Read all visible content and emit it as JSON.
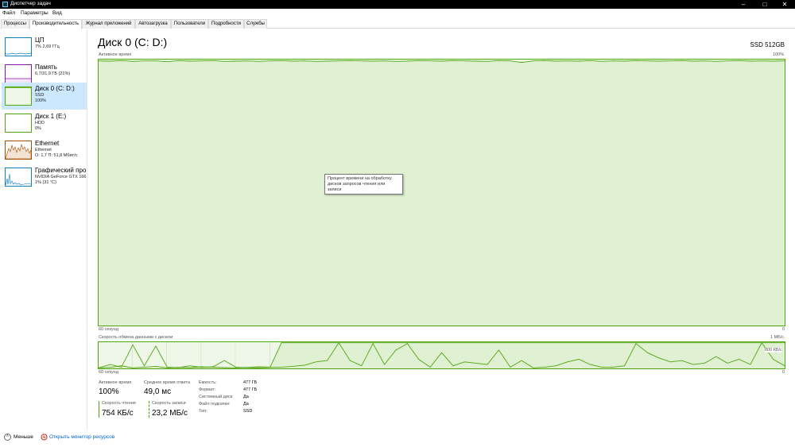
{
  "window": {
    "title": "Диспетчер задач",
    "controls": {
      "minimize": "–",
      "maximize": "□",
      "close": "✕"
    }
  },
  "menu": [
    "Файл",
    "Параметры",
    "Вид"
  ],
  "tabs": [
    "Процессы",
    "Производительность",
    "Журнал приложений",
    "Автозагрузка",
    "Пользователи",
    "Подробности",
    "Службы"
  ],
  "active_tab": "Производительность",
  "sidebar": [
    {
      "name": "ЦП",
      "line1": "7% 2,69 ГГц",
      "line2": "",
      "color": "#117dbb"
    },
    {
      "name": "Память",
      "line1": "6,7/31,9 ГБ (21%)",
      "line2": "",
      "color": "#8b12ae"
    },
    {
      "name": "Диск 0 (C: D:)",
      "line1": "SSD",
      "line2": "100%",
      "color": "#4da60c",
      "selected": true
    },
    {
      "name": "Диск 1 (E:)",
      "line1": "HDD",
      "line2": "0%",
      "color": "#4da60c"
    },
    {
      "name": "Ethernet",
      "line1": "Ethernet",
      "line2": "О: 1,7 П: 51,8 Мбит/с",
      "color": "#a74f01"
    },
    {
      "name": "Графический про",
      "line1": "NVIDIA GeForce GTX 166",
      "line2": "1% (31 °C)",
      "color": "#117dbb"
    }
  ],
  "main": {
    "title": "Диск 0 (C: D:)",
    "model": "SSD 512GB",
    "active_graph": {
      "label": "Активное время",
      "max_label": "100%",
      "x_label": "60 секунд",
      "min_label": "0"
    },
    "transfer_graph": {
      "label": "Скорость обмена данными с диском",
      "max_label": "1 МБ/с",
      "mid_label": "800 КБ/с",
      "x_label": "60 секунд",
      "min_label": "0"
    },
    "tooltip": "Процент времени на обработку дисков запросов чтения или записи"
  },
  "stats": {
    "active_time": {
      "label": "Активное время",
      "value": "100%"
    },
    "avg_response": {
      "label": "Среднее время ответа",
      "value": "49,0 мс"
    },
    "read_speed": {
      "label": "Скорость чтения",
      "value": "754 КБ/с"
    },
    "write_speed": {
      "label": "Скорость записи",
      "value": "23,2 МБ/с"
    }
  },
  "info": [
    {
      "label": "Емкость:",
      "value": "477 ГБ"
    },
    {
      "label": "Формат:",
      "value": "477 ГБ"
    },
    {
      "label": "Системный диск:",
      "value": "Да"
    },
    {
      "label": "Файл подкачки:",
      "value": "Да"
    },
    {
      "label": "Тип:",
      "value": "SSD"
    }
  ],
  "bottom": {
    "less": "Меньше",
    "resource_monitor": "Открыть монитор ресурсов"
  },
  "colors": {
    "disk_green": "#4da60c",
    "graph_fill": "#eff7e8",
    "grid": "#d1e8c2",
    "link_blue": "#0066cc",
    "selected_bg": "#cce8ff"
  },
  "active_series": [
    99.5,
    99.4,
    99.6,
    99.3,
    99.5,
    99.5,
    99.2,
    99.6,
    99.4,
    99.5,
    99.6,
    99.3,
    99.4,
    99.5,
    99.3,
    99.5,
    99.6,
    99.4,
    99.5,
    99.3,
    99.4,
    99.5,
    99.6,
    99.5,
    99.4,
    99.5,
    99.3,
    99.4,
    99.6,
    99.5,
    99.4,
    99.6,
    99.5,
    99.4,
    99.3,
    99.6,
    99.5,
    98.9,
    99.5,
    99.6,
    99.4,
    99.5,
    99.4,
    99.6,
    99.3,
    99.5,
    99.4,
    99.6,
    99.5,
    99.4,
    99.5,
    99.6,
    99.4,
    99.5,
    99.3,
    99.5,
    99.6,
    99.4,
    99.5,
    99.4,
    99.5
  ],
  "read_series": [
    0.02,
    0.04,
    0.1,
    0.02,
    0.05,
    0.08,
    0.02,
    0.04,
    0.03,
    0.06,
    0.05,
    0.03,
    0.02,
    0.04,
    0.06,
    0.05,
    0.98,
    0.98,
    0.98,
    0.98,
    0.98,
    0.98,
    0.98,
    0.98,
    0.98,
    0.98,
    0.98,
    0.98,
    0.98,
    0.98,
    0.98,
    0.98,
    0.98,
    0.98,
    0.98,
    0.98,
    0.98,
    0.98,
    0.98,
    0.98,
    0.98,
    0.98,
    0.98,
    0.98,
    0.98,
    0.98,
    0.98,
    0.98,
    0.98,
    0.98,
    0.98,
    0.98,
    0.98,
    0.98,
    0.98,
    0.98,
    0.98,
    0.98,
    0.98,
    0.98,
    0.98
  ],
  "write_series": [
    0.02,
    0.15,
    0.05,
    0.9,
    0.1,
    0.85,
    0.05,
    0.03,
    0.1,
    0.04,
    0.06,
    0.3,
    0.05,
    0.03,
    0.02,
    0.04,
    0.05,
    0.08,
    0.12,
    0.25,
    0.3,
    0.98,
    0.3,
    0.1,
    0.95,
    0.15,
    0.7,
    0.95,
    0.35,
    0.05,
    0.6,
    0.1,
    0.25,
    0.2,
    0.15,
    0.7,
    0.05,
    0.3,
    0.02,
    0.05,
    0.1,
    0.25,
    0.35,
    0.15,
    0.05,
    0.05,
    0.1,
    0.95,
    0.6,
    0.4,
    0.25,
    0.3,
    0.15,
    0.2,
    0.45,
    0.2,
    0.35,
    0.15,
    0.98,
    0.35,
    0.1
  ]
}
